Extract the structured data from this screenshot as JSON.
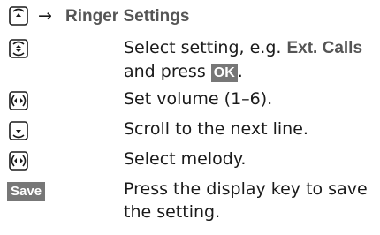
{
  "header": {
    "arrow": "→",
    "title": "Ringer Settings"
  },
  "steps": [
    {
      "key_icon": "nav-up-down-icon",
      "text_before": "Select setting, e.g. ",
      "keyword": "Ext. Calls",
      "text_middle": " and press ",
      "softkey": "OK",
      "text_after": "."
    },
    {
      "key_icon": "nav-left-right-icon",
      "text": "Set volume (1–6)."
    },
    {
      "key_icon": "nav-down-icon",
      "text": "Scroll to the next line."
    },
    {
      "key_icon": "nav-left-right-icon",
      "text": "Select melody."
    },
    {
      "display_key": "Save",
      "text": "Press the display key to save the setting."
    }
  ]
}
